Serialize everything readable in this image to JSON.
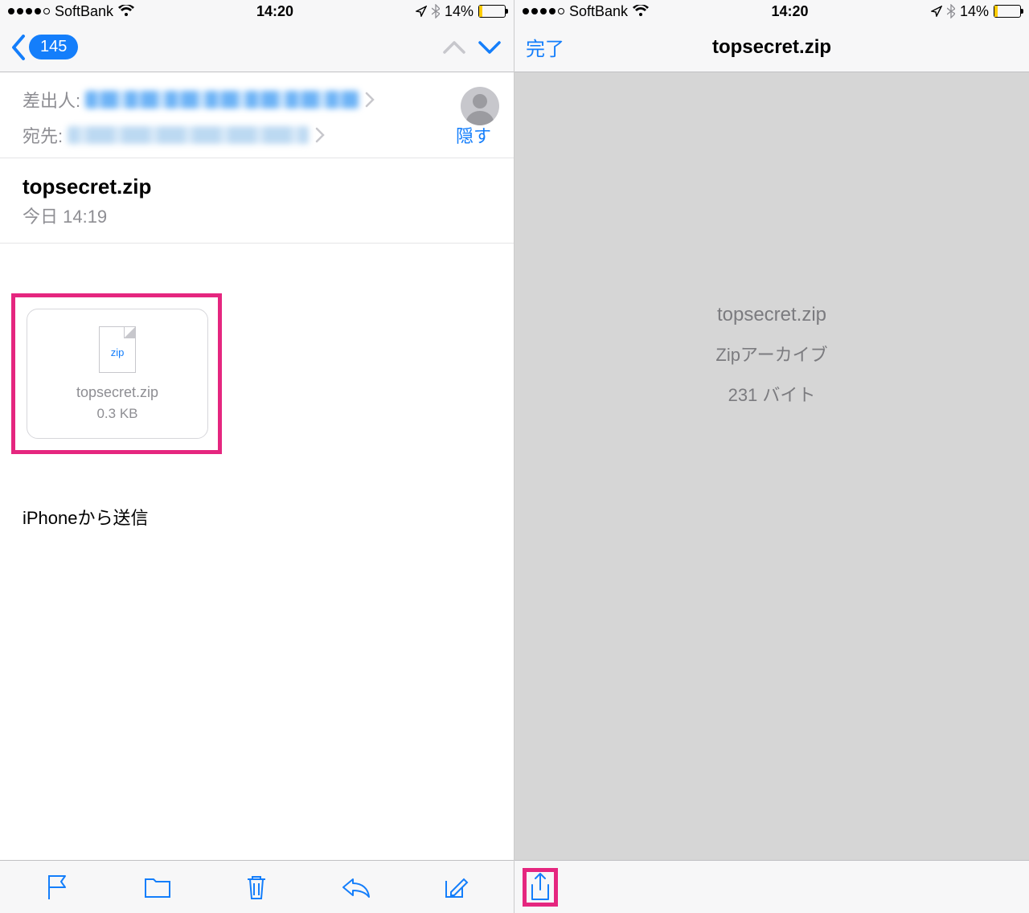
{
  "status": {
    "carrier": "SoftBank",
    "time": "14:20",
    "battery_pct": "14%"
  },
  "left": {
    "nav": {
      "badge": "145"
    },
    "header": {
      "from_label": "差出人:",
      "to_label": "宛先:",
      "hide": "隠す"
    },
    "subject": {
      "title": "topsecret.zip",
      "date": "今日 14:19"
    },
    "attachment": {
      "ext": "zip",
      "name": "topsecret.zip",
      "size": "0.3 KB"
    },
    "signature": "iPhoneから送信"
  },
  "right": {
    "nav": {
      "done": "完了",
      "title": "topsecret.zip"
    },
    "preview": {
      "name": "topsecret.zip",
      "type": "Zipアーカイブ",
      "size": "231 バイト"
    }
  }
}
